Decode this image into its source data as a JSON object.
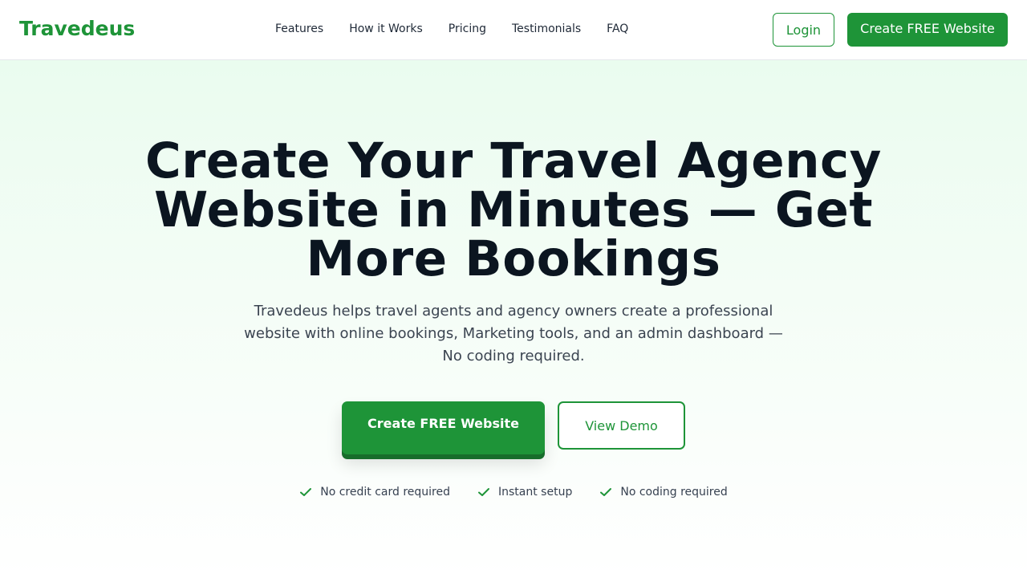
{
  "nav": {
    "logo": "Travedeus",
    "links": [
      "Features",
      "How it Works",
      "Pricing",
      "Testimonials",
      "FAQ"
    ],
    "login_label": "Login",
    "cta_label": "Create FREE Website"
  },
  "hero": {
    "title": "Create Your Travel Agency Website in Minutes — Get More Bookings",
    "subtitle": "Travedeus helps travel agents and agency owners create a professional website with online bookings, Marketing tools, and an admin dashboard — No coding required.",
    "primary_cta": "Create FREE Website",
    "secondary_cta": "View Demo",
    "badges": [
      {
        "icon": "check-icon",
        "label": "No credit card required"
      },
      {
        "icon": "check-icon",
        "label": "Instant setup"
      },
      {
        "icon": "check-icon",
        "label": "No coding required"
      }
    ]
  },
  "colors": {
    "brand": "#1e9438",
    "heading": "#0b1520",
    "hero_bg_top": "#eafcef"
  }
}
